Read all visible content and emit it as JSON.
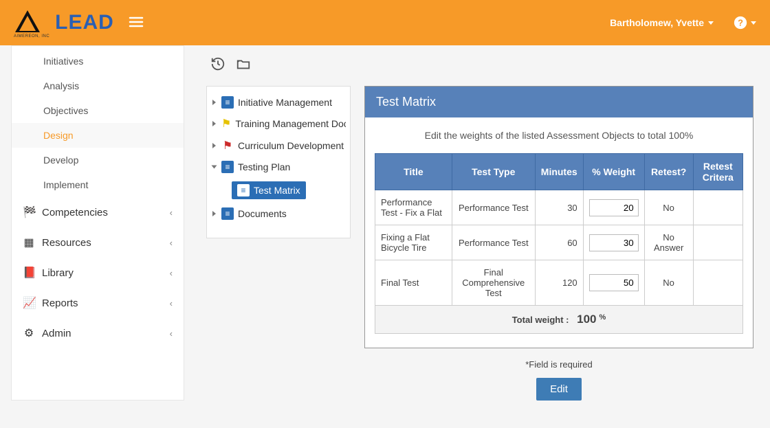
{
  "header": {
    "brand": "LEAD",
    "brand_sub": "AIMEREON, INC",
    "user_name": "Bartholomew, Yvette"
  },
  "sidebar": {
    "items": [
      {
        "label": "Initiatives",
        "active": false
      },
      {
        "label": "Analysis",
        "active": false
      },
      {
        "label": "Objectives",
        "active": false
      },
      {
        "label": "Design",
        "active": true
      },
      {
        "label": "Develop",
        "active": false
      },
      {
        "label": "Implement",
        "active": false
      }
    ],
    "sections": [
      {
        "label": "Competencies"
      },
      {
        "label": "Resources"
      },
      {
        "label": "Library"
      },
      {
        "label": "Reports"
      },
      {
        "label": "Admin"
      }
    ]
  },
  "tree": {
    "items": [
      {
        "label": "Initiative Management",
        "icon": "doc-blue"
      },
      {
        "label": "Training Management Doc",
        "icon": "flag-y"
      },
      {
        "label": "Curriculum Development",
        "icon": "flag-r"
      },
      {
        "label": "Testing Plan",
        "icon": "doc-blue",
        "open": true
      },
      {
        "label": "Test Matrix",
        "icon": "doc-blue",
        "child": true,
        "selected": true
      },
      {
        "label": "Documents",
        "icon": "doc-blue"
      }
    ]
  },
  "panel": {
    "title": "Test Matrix",
    "subtitle": "Edit the weights of the listed Assessment Objects to total 100%",
    "columns": {
      "title": "Title",
      "type": "Test Type",
      "minutes": "Minutes",
      "weight": "% Weight",
      "retest": "Retest?",
      "criteria": "Retest Critera"
    },
    "rows": [
      {
        "title": "Performance Test - Fix a Flat",
        "type": "Performance Test",
        "minutes": "30",
        "weight": "20",
        "retest": "No",
        "criteria": ""
      },
      {
        "title": "Fixing a Flat Bicycle Tire",
        "type": "Performance Test",
        "minutes": "60",
        "weight": "30",
        "retest": "No Answer",
        "criteria": ""
      },
      {
        "title": "Final Test",
        "type": "Final Comprehensive Test",
        "minutes": "120",
        "weight": "50",
        "retest": "No",
        "criteria": ""
      }
    ],
    "total_label": "Total weight :",
    "total_value": "100",
    "total_pct": "%",
    "required_note": "*Field is required",
    "edit_label": "Edit"
  }
}
